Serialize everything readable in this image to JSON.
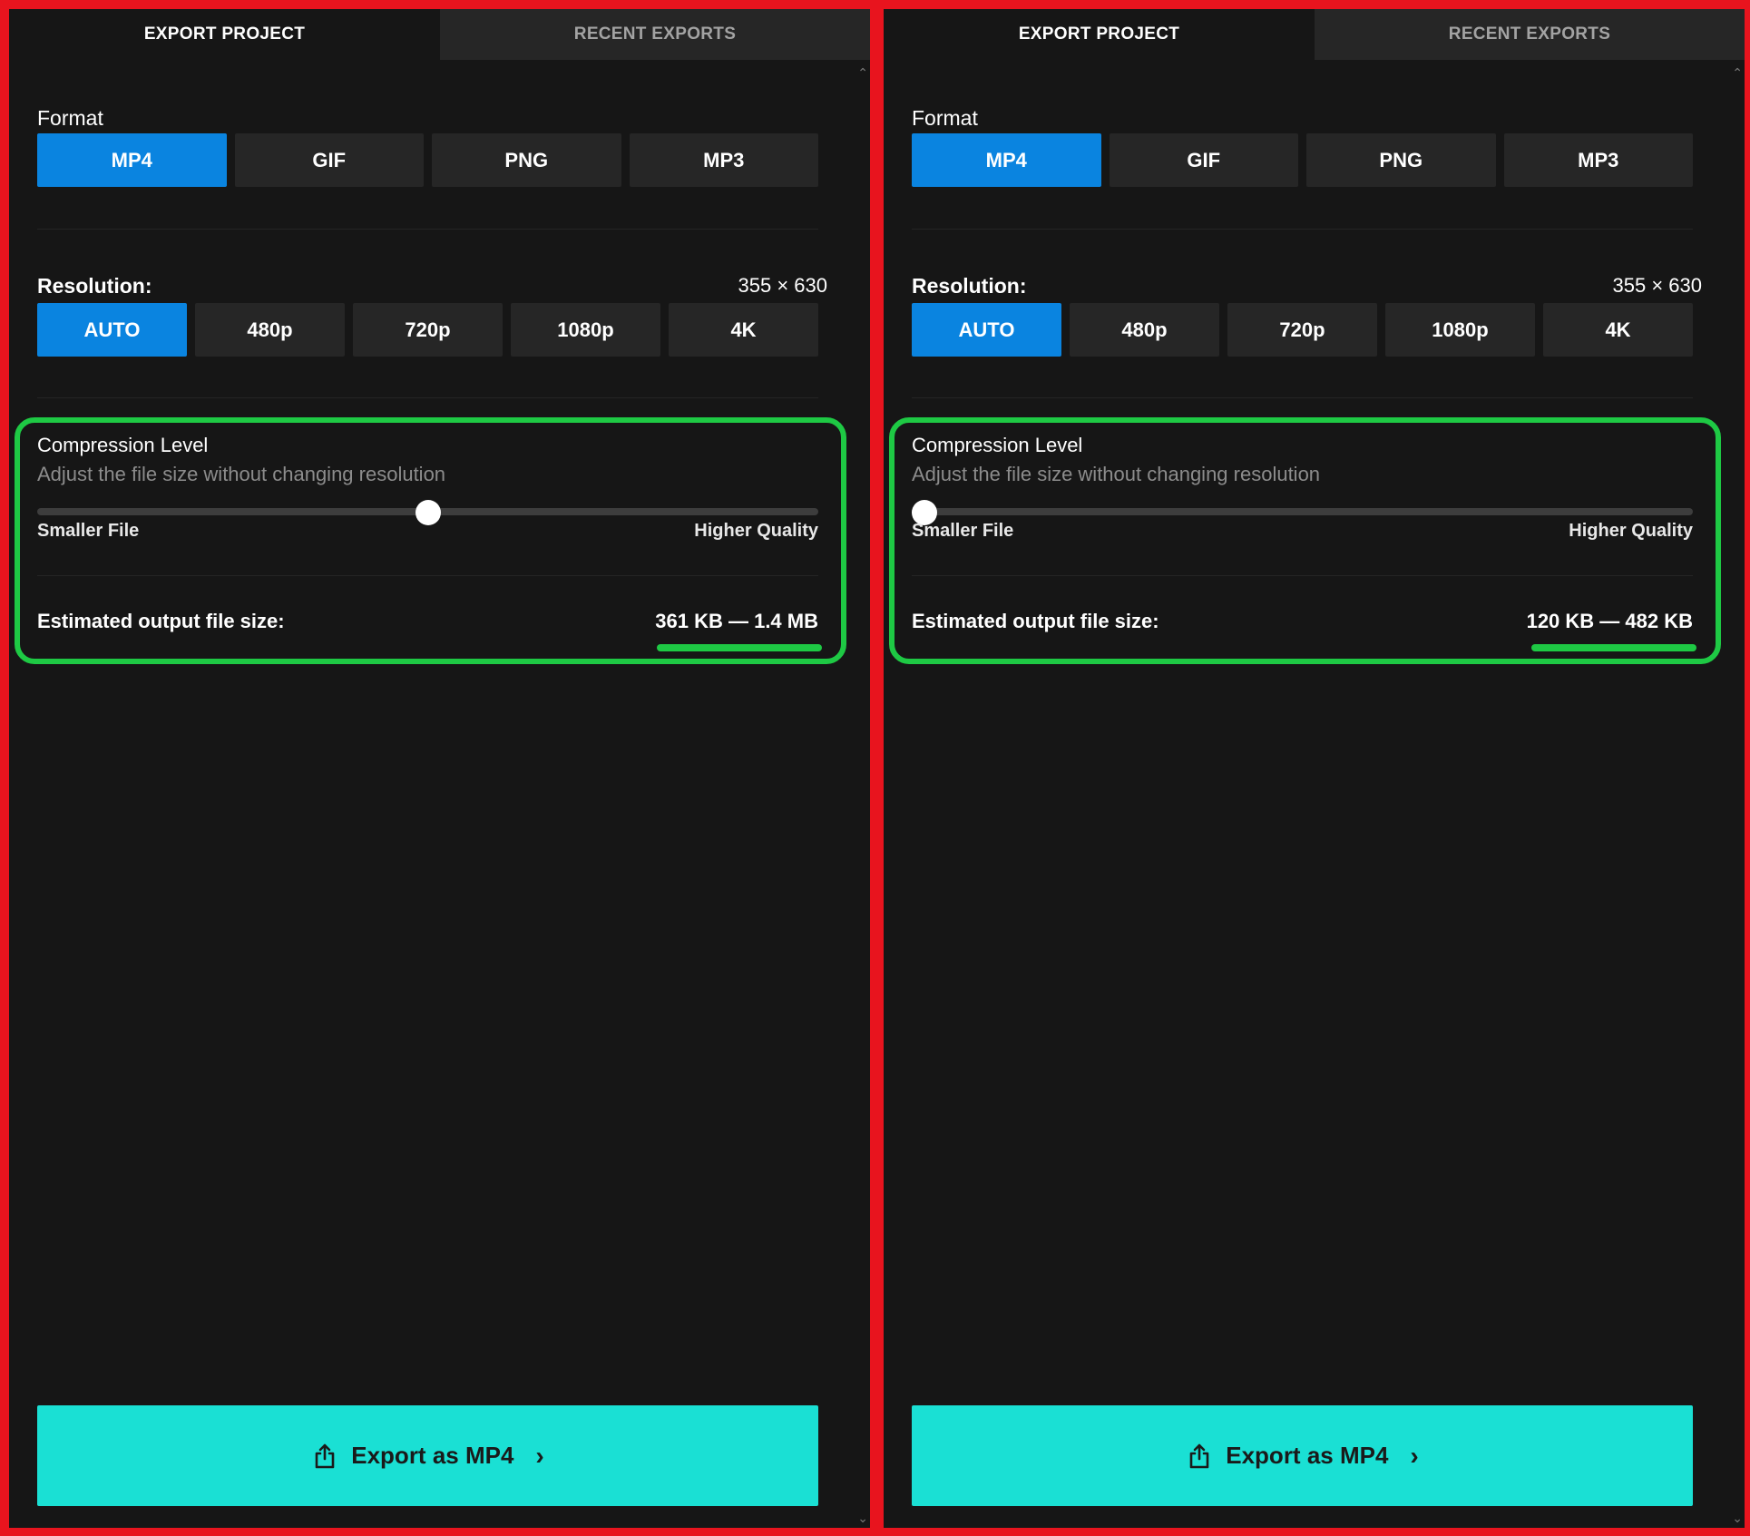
{
  "panels": [
    {
      "tabs": {
        "active": "EXPORT PROJECT",
        "inactive": "RECENT EXPORTS"
      },
      "format": {
        "label": "Format",
        "options": [
          "MP4",
          "GIF",
          "PNG",
          "MP3"
        ],
        "selected": "MP4"
      },
      "resolution": {
        "label": "Resolution:",
        "dimensions": "355 × 630",
        "options": [
          "AUTO",
          "480p",
          "720p",
          "1080p",
          "4K"
        ],
        "selected": "AUTO"
      },
      "compression": {
        "title": "Compression Level",
        "subtitle": "Adjust the file size without changing resolution",
        "min_label": "Smaller File",
        "max_label": "Higher Quality",
        "value": 0.5
      },
      "estimate": {
        "label": "Estimated output file size:",
        "value": "361 KB — 1.4 MB"
      },
      "export_button": {
        "label": "Export as MP4",
        "icon": "share-export-icon"
      }
    },
    {
      "tabs": {
        "active": "EXPORT PROJECT",
        "inactive": "RECENT EXPORTS"
      },
      "format": {
        "label": "Format",
        "options": [
          "MP4",
          "GIF",
          "PNG",
          "MP3"
        ],
        "selected": "MP4"
      },
      "resolution": {
        "label": "Resolution:",
        "dimensions": "355 × 630",
        "options": [
          "AUTO",
          "480p",
          "720p",
          "1080p",
          "4K"
        ],
        "selected": "AUTO"
      },
      "compression": {
        "title": "Compression Level",
        "subtitle": "Adjust the file size without changing resolution",
        "min_label": "Smaller File",
        "max_label": "Higher Quality",
        "value": 0.0
      },
      "estimate": {
        "label": "Estimated output file size:",
        "value": "120 KB — 482 KB"
      },
      "export_button": {
        "label": "Export as MP4",
        "icon": "share-export-icon"
      }
    }
  ],
  "colors": {
    "background": "#161616",
    "accent_selected": "#0a84e0",
    "export_button": "#1ae0d4",
    "highlight": "#1ec944",
    "frame": "#e8141e"
  }
}
